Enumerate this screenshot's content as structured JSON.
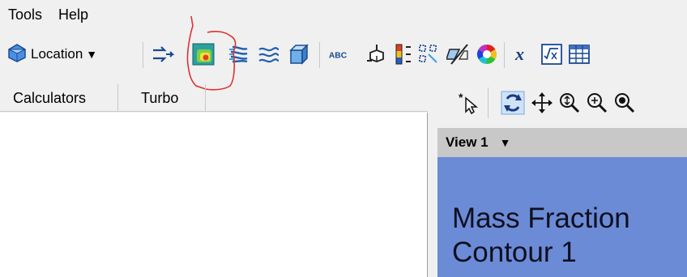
{
  "menu": {
    "items": [
      "Tools",
      "Help"
    ]
  },
  "toolbar": {
    "location_label": "Location",
    "abc_glyph": "ABC",
    "icons": [
      "location-icon",
      "insert-arrows-icon",
      "contour-icon",
      "streamline-icon",
      "vector-field-icon",
      "volume-box-icon",
      "text-label-icon",
      "probe-icon",
      "legend-icon",
      "polyline-icon",
      "clip-plane-icon",
      "color-wheel-icon",
      "variable-icon",
      "expression-icon",
      "table-icon"
    ]
  },
  "tabs": {
    "calculators": "Calculators",
    "turbo": "Turbo"
  },
  "viewer_toolbar": {
    "icons": [
      "select-icon",
      "rotate-icon",
      "pan-icon",
      "zoom-box-icon",
      "zoom-icon",
      "fit-view-icon"
    ]
  },
  "view": {
    "title": "View 1",
    "labels": [
      "Mass Fraction",
      "Contour 1"
    ],
    "background": "#6b8bd6"
  },
  "colors": {
    "annotation": "#e03030",
    "accent": "#1060c0"
  }
}
